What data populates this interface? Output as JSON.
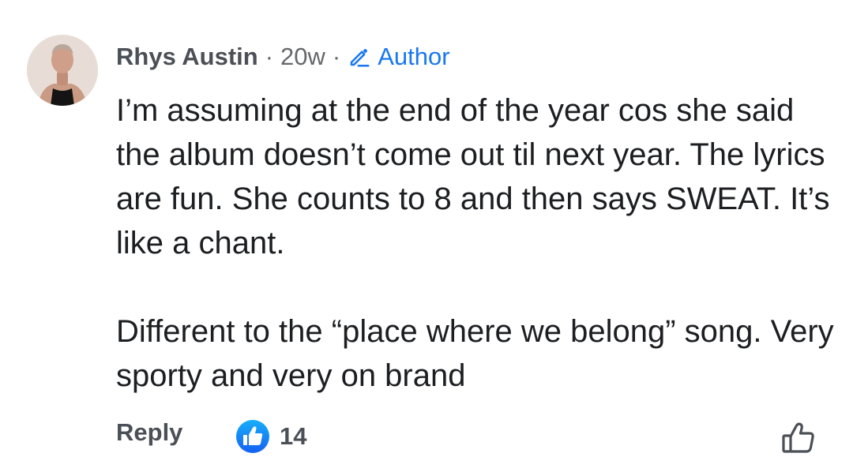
{
  "comment": {
    "author": "Rhys Austin",
    "separator": "·",
    "time": "20w",
    "badge_icon": "pencil-icon",
    "badge_label": "Author",
    "paragraphs": [
      "I’m assuming at the end of the year cos she said the album doesn’t come out til next year. The lyrics are fun. She counts to 8 and then says SWEAT. It’s like a chant.",
      "Different to the “place where we belong” song. Very sporty and very on brand"
    ],
    "reply_label": "Reply",
    "reaction_icon": "like-badge-icon",
    "reaction_count": "14",
    "like_icon": "thumbs-up-outline-icon"
  },
  "colors": {
    "accent": "#1877f2",
    "text_primary": "#1c1e21",
    "text_secondary": "#65676b",
    "text_meta": "#4b4f56"
  }
}
